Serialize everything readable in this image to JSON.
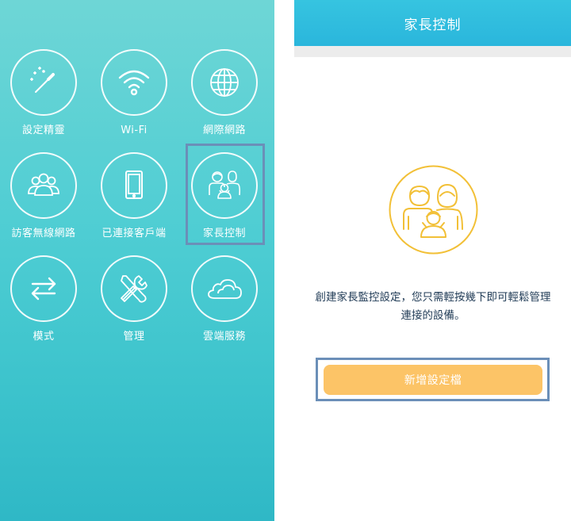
{
  "left_menu": {
    "items": [
      {
        "label": "設定精靈",
        "icon": "magic-wand-icon"
      },
      {
        "label": "Wi-Fi",
        "icon": "wifi-icon"
      },
      {
        "label": "網際網路",
        "icon": "globe-icon"
      },
      {
        "label": "訪客無線網路",
        "icon": "guest-users-icon"
      },
      {
        "label": "已連接客戶端",
        "icon": "tablet-icon"
      },
      {
        "label": "家長控制",
        "icon": "family-icon"
      },
      {
        "label": "模式",
        "icon": "switch-arrows-icon"
      },
      {
        "label": "管理",
        "icon": "tools-icon"
      },
      {
        "label": "雲端服務",
        "icon": "cloud-icon"
      }
    ],
    "colors": {
      "background": "#4ecdd3",
      "highlight": "#6b8fb8"
    }
  },
  "parental_control": {
    "title": "家長控制",
    "description": "創建家長監控設定，您只需輕按幾下即可輕鬆管理連接的設備。",
    "add_button_label": "新增設定檔",
    "icon": "family-icon",
    "colors": {
      "header": "#2ab6dc",
      "button": "#fcc467",
      "icon": "#f2c037",
      "text": "#1f3a55"
    }
  }
}
